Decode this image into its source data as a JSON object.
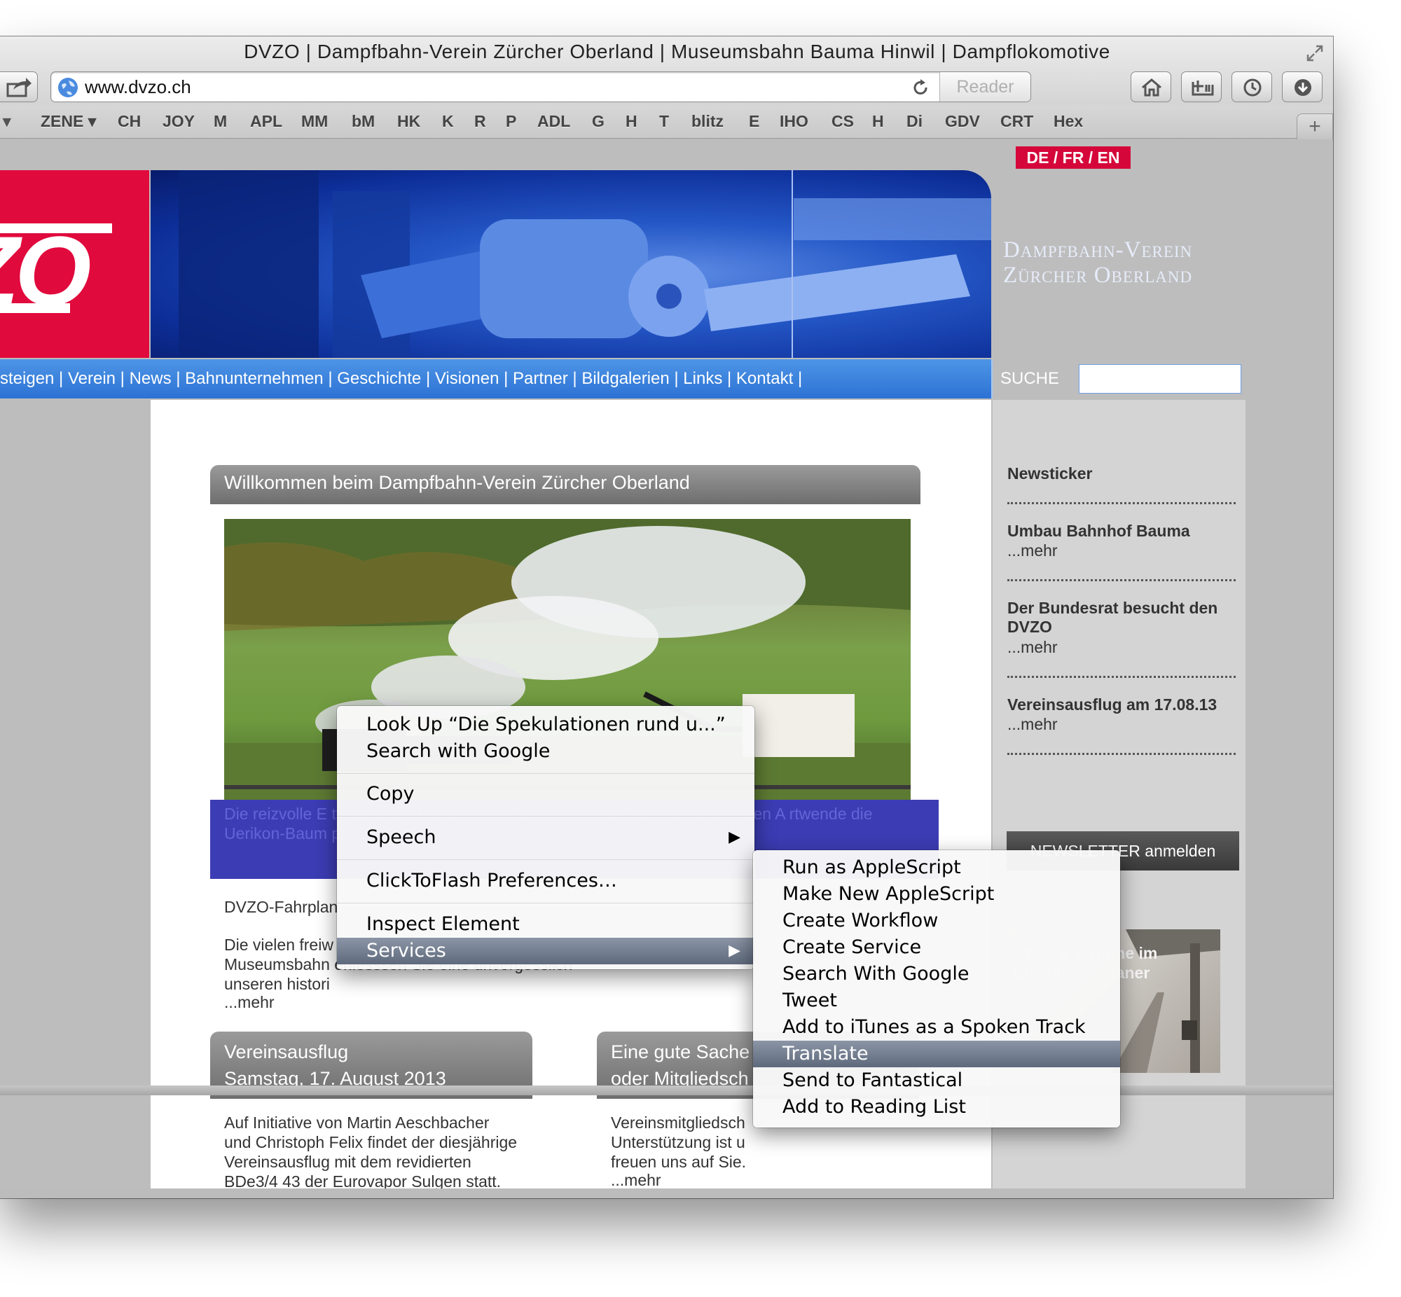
{
  "window": {
    "title": "DVZO | Dampfbahn-Verein Zürcher Oberland | Museumsbahn Bauma Hinwil | Dampflokomotive"
  },
  "toolbar": {
    "url": "www.dvzo.ch",
    "reader_label": "Reader"
  },
  "bookmarks": [
    "ZENE",
    "CH",
    "JOY",
    "M",
    "APL",
    "MM",
    "bM",
    "HK",
    "K",
    "R",
    "P",
    "ADL",
    "G",
    "H",
    "T",
    "blitz",
    "E",
    "IHO",
    "CS",
    "H",
    "Di",
    "GDV",
    "CRT",
    "Hex"
  ],
  "bookmarks_add": "+",
  "site": {
    "lang": "DE / FR / EN",
    "logo": "ZO",
    "banner_title_line1": "Dampfbahn-Verein",
    "banner_title_line2": "Zürcher Oberland",
    "nav": "steigen | Verein | News | Bahnunternehmen | Geschichte | Visionen | Partner | Bildgalerien | Links | Kontakt |",
    "search_label": "SUCHE",
    "welcome_header": "Willkommen beim Dampfbahn-Verein Zürcher Oberland",
    "overlay_text": "Die reizvolle E                                                                 ttswil nach Hinwil ist eine Bahnlinie                                                                    m berühmten Industriellen A                                                                        rtwende die Uerikon-Baum                                                                    projekt Guyers.",
    "fahrplan_link": "DVZO-Fahrplan",
    "intro_line1": "Die vielen freiw                                         willigen «Eisenbahnler» heissen Sie herzlich willkommen",
    "intro_line2": "Museumsbahn                                    eniesssen Sie eine unvergesslich",
    "intro_line3": "unseren histori",
    "more": "...mehr",
    "box1_header_line1": "Vereinsausflug",
    "box1_header_line2": "Samstag, 17. August 2013",
    "box1_text": "Auf Initiative von Martin Aeschbacher und Christoph Felix findet der diesjährige Vereinsausflug mit dem revidierten BDe3/4 43 der Eurovapor Sulgen statt. Die Reise geht mit dem",
    "box2_header_line1": "Eine gute Sache",
    "box2_header_line2": "oder Mitgliedsch",
    "box2_text_line1": "Vereinsmitgliedsch",
    "box2_text_line2": "Unterstützung ist u",
    "box2_text_line3": "freuen uns auf Sie.",
    "newsticker_title": "Newsticker",
    "news": [
      {
        "title": "Umbau Bahnhof Bauma",
        "more": "...mehr"
      },
      {
        "title": "Der Bundesrat besucht den DVZO",
        "more": "...mehr"
      },
      {
        "title": "Vereinsausflug am 17.08.13",
        "more": "...mehr"
      }
    ],
    "newsletter_label": "NEWSLETTER  anmelden",
    "planer_text": "Unsere Termine im Eisenbahn-Planer"
  },
  "context_menu": {
    "items": [
      "Look Up “Die Spekulationen rund u...”",
      "Search with Google",
      "Copy",
      "Speech",
      "ClickToFlash Preferences…",
      "Inspect Element",
      "Services"
    ],
    "arrow": "▶"
  },
  "services_menu": {
    "items": [
      "Run as AppleScript",
      "Make New AppleScript",
      "Create Workflow",
      "Create Service",
      "Search With Google",
      "Tweet",
      "Add to iTunes as a Spoken Track",
      "Translate",
      "Send to Fantastical",
      "Add to Reading List"
    ],
    "selected": "Translate"
  },
  "colors": {
    "brand_red": "#e10a3d",
    "nav_blue": "#2d72d4",
    "menu_highlight": "#6b7688"
  }
}
